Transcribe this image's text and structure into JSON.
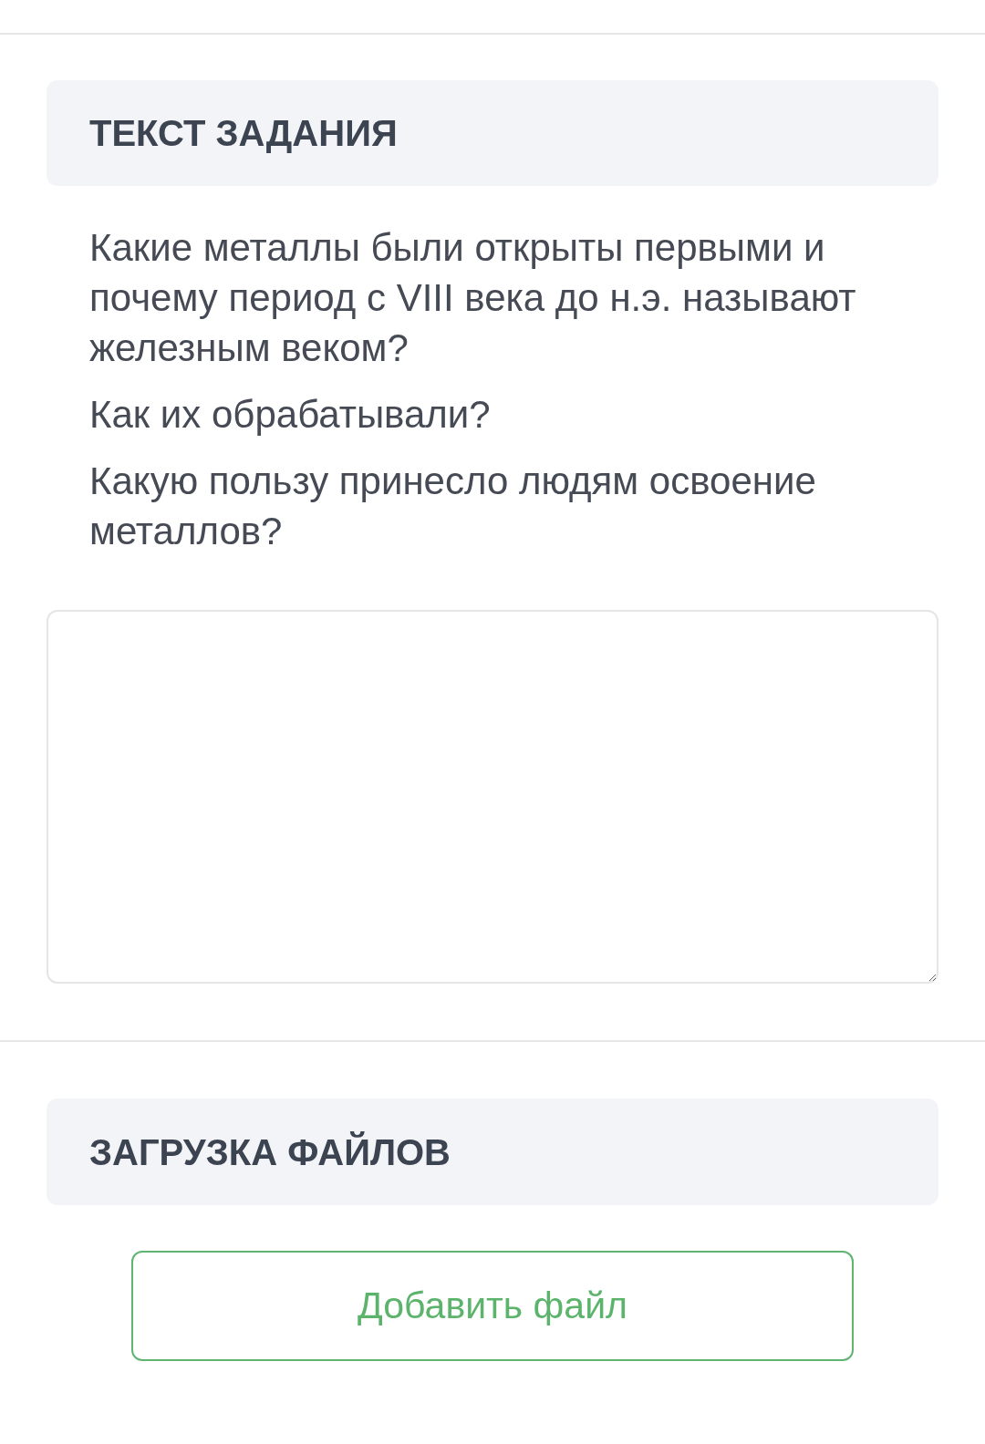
{
  "task_section": {
    "title": "ТЕКСТ ЗАДАНИЯ",
    "paragraphs": [
      "Какие металлы были открыты первыми и почему период с VIII века до н.э. называют железным веком?",
      "Как их обрабатывали?",
      "Какую пользу принесло людям освоение металлов?"
    ]
  },
  "upload_section": {
    "title": "ЗАГРУЗКА ФАЙЛОВ",
    "button": "Добавить файл"
  }
}
